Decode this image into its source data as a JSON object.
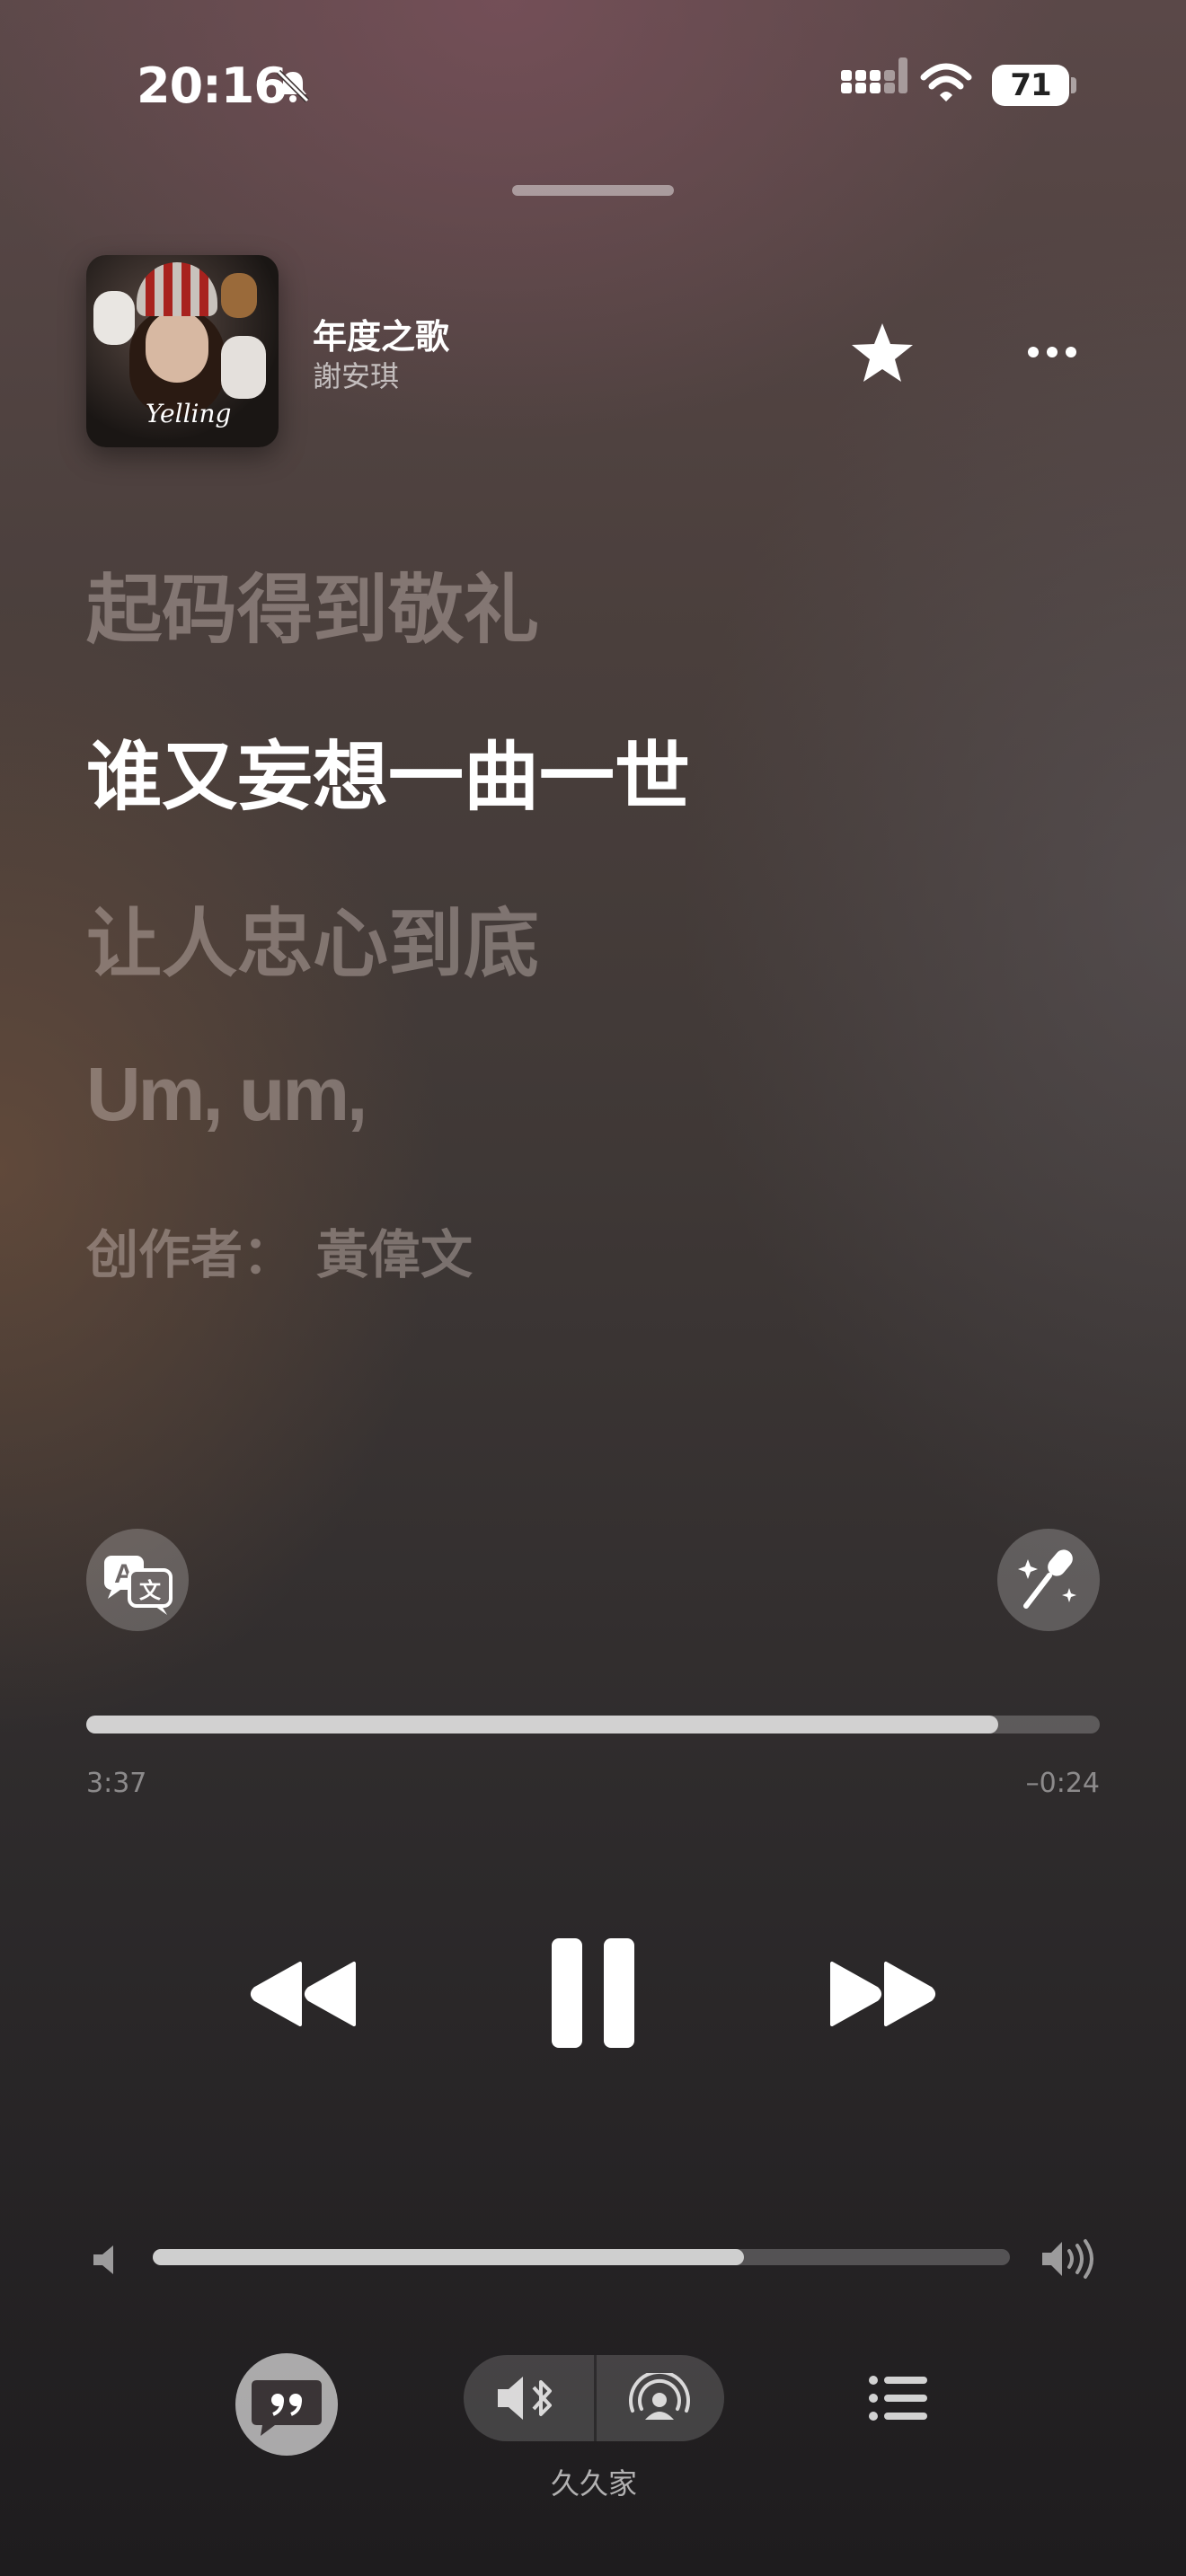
{
  "status_bar": {
    "time": "20:16",
    "battery": "71",
    "icons": [
      "bell-slash-icon",
      "cellular-signal-icon",
      "wifi-icon",
      "battery-icon"
    ]
  },
  "now_playing": {
    "title": "年度之歌",
    "artist": "謝安琪",
    "artwork_text": "Yelling",
    "icons": [
      "star-icon",
      "more-icon"
    ]
  },
  "lyrics": {
    "lines": [
      {
        "text": "起码得到敬礼",
        "active": false
      },
      {
        "text": "谁又妄想一曲一世",
        "active": true
      },
      {
        "text": "让人忠心到底",
        "active": false
      },
      {
        "text": "Um, um,",
        "active": false
      }
    ],
    "credit_label": "创作者：",
    "credit_name": "黃偉文"
  },
  "controls": {
    "translate_icon": "translate-icon",
    "sing_icon": "microphone-sparkle-icon",
    "elapsed": "3:37",
    "remaining": "–0:24",
    "progress_fraction": 0.9,
    "transport_icons": [
      "rewind-icon",
      "pause-icon",
      "fast-forward-icon"
    ],
    "volume_fraction": 0.69
  },
  "bottom_bar": {
    "route_label": "久久家",
    "icons": [
      "lyrics-quote-icon",
      "speaker-bluetooth-icon",
      "airplay-icon",
      "queue-list-icon"
    ]
  },
  "colors": {
    "accent": "#ffffff",
    "dim_text": "#d2c3be"
  }
}
